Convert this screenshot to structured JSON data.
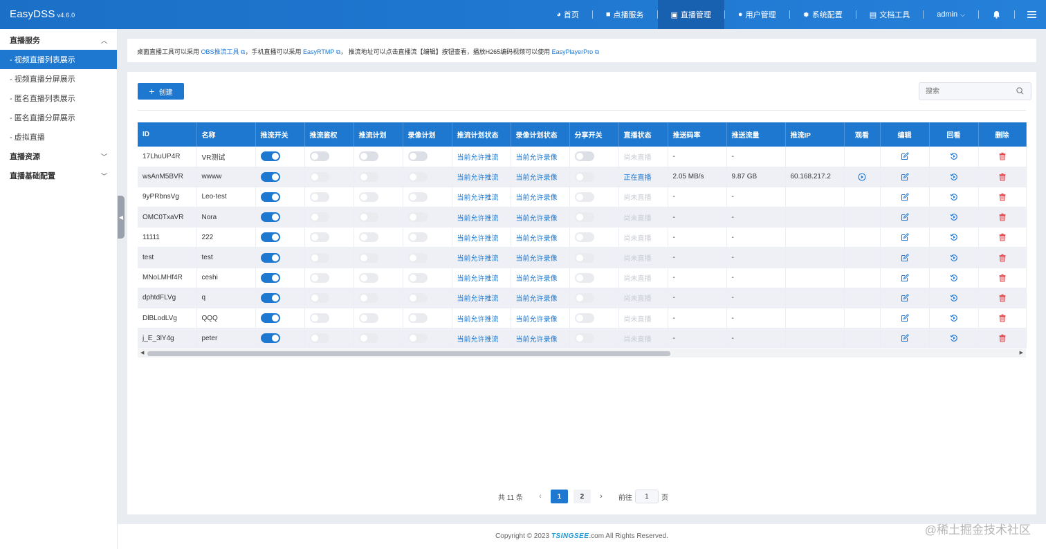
{
  "app": {
    "name": "EasyDSS",
    "version": "v4.6.0"
  },
  "nav": [
    {
      "icon": "dashboard-icon",
      "label": "首页",
      "glyph": "◕"
    },
    {
      "icon": "video-camera-icon",
      "label": "点播服务",
      "glyph": "■"
    },
    {
      "icon": "calendar-icon",
      "label": "直播管理",
      "glyph": "▣",
      "active": true
    },
    {
      "icon": "user-icon",
      "label": "用户管理",
      "glyph": "●"
    },
    {
      "icon": "gear-icon",
      "label": "系统配置",
      "glyph": "✹"
    },
    {
      "icon": "book-icon",
      "label": "文档工具",
      "glyph": "▤"
    }
  ],
  "user": {
    "name": "admin"
  },
  "sidebar": {
    "groups": [
      {
        "label": "直播服务",
        "expanded": true,
        "items": [
          "- 视频直播列表展示",
          "- 视频直播分屏展示",
          "- 匿名直播列表展示",
          "- 匿名直播分屏展示",
          "- 虚拟直播"
        ]
      },
      {
        "label": "直播资源",
        "expanded": false
      },
      {
        "label": "直播基础配置",
        "expanded": false
      }
    ]
  },
  "notice": {
    "p1": "桌面直播工具可以采用 ",
    "l1": "OBS推流工具",
    "p2": "，手机直播可以采用 ",
    "l2": "EasyRTMP",
    "p3": "， 推流地址可以点击直播流【编辑】按钮查看，播放H265编码视频可以使用 ",
    "l3": "EasyPlayerPro"
  },
  "toolbar": {
    "create_label": "创建",
    "search_placeholder": "搜索"
  },
  "table": {
    "columns": [
      "ID",
      "名称",
      "推流开关",
      "推流鉴权",
      "推流计划",
      "录像计划",
      "推流计划状态",
      "录像计划状态",
      "分享开关",
      "直播状态",
      "推送码率",
      "推送流量",
      "推流IP",
      "观看",
      "编辑",
      "回看",
      "删除"
    ],
    "rows": [
      {
        "id": "17LhuUP4R",
        "name": "VR测试",
        "push_plan_status": "当前允许推流",
        "record_plan_status": "当前允许录像",
        "live_status": "尚未直播",
        "live": false,
        "bitrate": "-",
        "traffic": "-",
        "ip": ""
      },
      {
        "id": "wsAnM5BVR",
        "name": "wwww",
        "push_plan_status": "当前允许推流",
        "record_plan_status": "当前允许录像",
        "live_status": "正在直播",
        "live": true,
        "bitrate": "2.05 MB/s",
        "traffic": "9.87 GB",
        "ip": "60.168.217.2"
      },
      {
        "id": "9yPRbnsVg",
        "name": "Leo-test",
        "push_plan_status": "当前允许推流",
        "record_plan_status": "当前允许录像",
        "live_status": "尚未直播",
        "live": false,
        "bitrate": "-",
        "traffic": "-",
        "ip": ""
      },
      {
        "id": "OMC0TxaVR",
        "name": "Nora",
        "push_plan_status": "当前允许推流",
        "record_plan_status": "当前允许录像",
        "live_status": "尚未直播",
        "live": false,
        "bitrate": "-",
        "traffic": "-",
        "ip": ""
      },
      {
        "id": "11111",
        "name": "222",
        "push_plan_status": "当前允许推流",
        "record_plan_status": "当前允许录像",
        "live_status": "尚未直播",
        "live": false,
        "bitrate": "-",
        "traffic": "-",
        "ip": ""
      },
      {
        "id": "test",
        "name": "test",
        "push_plan_status": "当前允许推流",
        "record_plan_status": "当前允许录像",
        "live_status": "尚未直播",
        "live": false,
        "bitrate": "-",
        "traffic": "-",
        "ip": ""
      },
      {
        "id": "MNoLMHf4R",
        "name": "ceshi",
        "push_plan_status": "当前允许推流",
        "record_plan_status": "当前允许录像",
        "live_status": "尚未直播",
        "live": false,
        "bitrate": "-",
        "traffic": "-",
        "ip": ""
      },
      {
        "id": "dphtdFLVg",
        "name": "q",
        "push_plan_status": "当前允许推流",
        "record_plan_status": "当前允许录像",
        "live_status": "尚未直播",
        "live": false,
        "bitrate": "-",
        "traffic": "-",
        "ip": ""
      },
      {
        "id": "DlBLodLVg",
        "name": "QQQ",
        "push_plan_status": "当前允许推流",
        "record_plan_status": "当前允许录像",
        "live_status": "尚未直播",
        "live": false,
        "bitrate": "-",
        "traffic": "-",
        "ip": ""
      },
      {
        "id": "j_E_3lY4g",
        "name": "peter",
        "push_plan_status": "当前允许推流",
        "record_plan_status": "当前允许录像",
        "live_status": "尚未直播",
        "live": false,
        "bitrate": "-",
        "traffic": "-",
        "ip": ""
      }
    ]
  },
  "pagination": {
    "total_text": "共 11 条",
    "pages": [
      "1",
      "2"
    ],
    "current": "1",
    "goto_prefix": "前往",
    "goto_value": "1",
    "goto_suffix": "页"
  },
  "footer": {
    "prefix": "Copyright © 2023 ",
    "brand": "TSINGSEE",
    "suffix": ".com All Rights Reserved."
  },
  "watermark": "@稀土掘金技术社区",
  "colors": {
    "primary": "#1e78d0",
    "topbar": "#2580d9",
    "active_nav": "#1860b0",
    "delete": "#e0393e"
  }
}
